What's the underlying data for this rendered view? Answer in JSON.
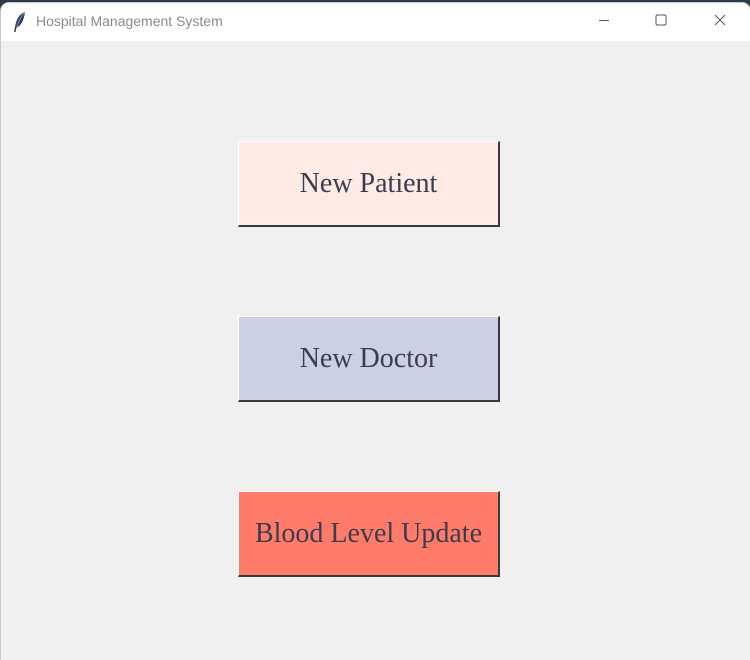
{
  "window": {
    "title": "Hospital Management System",
    "app_icon": "feather-icon",
    "controls": {
      "minimize_icon": "minimize-icon",
      "maximize_icon": "maximize-icon",
      "close_icon": "close-icon"
    }
  },
  "buttons": [
    {
      "label": "New Patient",
      "color": "#ffebe6"
    },
    {
      "label": "New Doctor",
      "color": "#cbd1e3"
    },
    {
      "label": "Blood Level Update",
      "color": "#ff7b69"
    }
  ],
  "colors": {
    "background": "#f0f0f0",
    "titlebar": "#ffffff",
    "button_text": "#3c3c4e"
  }
}
